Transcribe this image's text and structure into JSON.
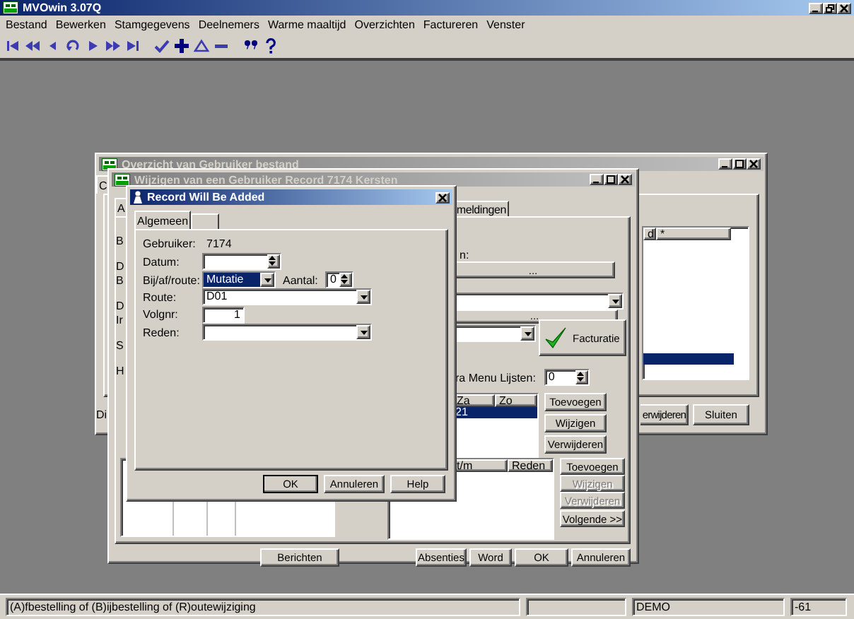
{
  "app": {
    "title": "MVOwin 3.07Q"
  },
  "menu": [
    "Bestand",
    "Bewerken",
    "Stamgegevens",
    "Deelnemers",
    "Warme maaltijd",
    "Overzichten",
    "Factureren",
    "Venster"
  ],
  "toolbar": [
    {
      "items": [
        {
          "kind": "first"
        },
        {
          "kind": "rewind"
        },
        {
          "kind": "previous"
        },
        {
          "kind": "undo"
        },
        {
          "kind": "next"
        },
        {
          "kind": "forward"
        },
        {
          "kind": "last"
        }
      ]
    },
    {
      "items": [
        {
          "kind": "check"
        },
        {
          "kind": "plus"
        },
        {
          "kind": "delta"
        },
        {
          "kind": "minus"
        }
      ]
    },
    {
      "items": [
        {
          "kind": "quote"
        },
        {
          "kind": "help"
        }
      ]
    }
  ],
  "overview": {
    "title": "Overzicht van Gebruiker bestand",
    "tab_label": "C",
    "footer_label": "Di",
    "columns": [
      "d",
      "*"
    ],
    "rows": [
      {
        "selected": false
      },
      {
        "selected": false
      },
      {
        "selected": false
      },
      {
        "selected": false
      },
      {
        "selected": false
      },
      {
        "selected": false
      },
      {
        "selected": false
      },
      {
        "selected": false
      },
      {
        "selected": false
      },
      {
        "selected": false
      },
      {
        "selected": true
      }
    ],
    "buttons": [
      "erwijderen",
      "Sluiten"
    ]
  },
  "editor": {
    "title": "Wijzigen van een Gebruiker Record 7174 Kersten",
    "tabs": [
      {
        "label": "A",
        "selected": true
      },
      {
        "label": "meldingen",
        "selected": false
      }
    ],
    "side_labels": [
      [
        "B"
      ],
      [
        "D",
        "B"
      ],
      [
        "D",
        "Ir"
      ],
      [
        "S"
      ],
      [
        "H"
      ]
    ],
    "field_label": "n:",
    "browse_buttons": [
      "...",
      "..."
    ],
    "invoice_button": "Facturatie",
    "menu_lists": {
      "label": "ra Menu Lijsten:",
      "value": "0"
    },
    "days_list": {
      "columns": [
        "Za",
        "Zo"
      ],
      "rows": [
        {
          "cells": [
            "21"
          ],
          "selected": true
        }
      ]
    },
    "days_buttons": [
      {
        "label": "Toevoegen",
        "disabled": false
      },
      {
        "label": "Wijzigen",
        "disabled": false
      },
      {
        "label": "Verwijderen",
        "disabled": false
      }
    ],
    "absence_list": {
      "columns": [
        "t/m",
        "Reden"
      ]
    },
    "absence_buttons": [
      {
        "label": "Toevoegen",
        "disabled": false
      },
      {
        "label": "Wijzigen",
        "disabled": true
      },
      {
        "label": "Verwijderen",
        "disabled": true
      },
      {
        "label": "Volgende >>",
        "disabled": false
      }
    ],
    "footer_buttons": [
      "Berichten",
      "Absenties",
      "Word",
      "OK",
      "Annuleren"
    ]
  },
  "dialog": {
    "title": "Record Will Be Added",
    "tabs": [
      {
        "label": "Algemeen",
        "selected": true
      },
      {
        "selected": false
      }
    ],
    "fields": [
      {
        "kind": "static",
        "label": "Gebruiker:",
        "value": "7174"
      },
      {
        "kind": "spin",
        "label": "Datum:"
      },
      {
        "kind": "short-combo",
        "label": "Bij/af/route:",
        "value": "Mutatie",
        "selected": true,
        "extra": {
          "label": "Aantal:",
          "value": "0"
        }
      },
      {
        "kind": "combo",
        "label": "Route:",
        "value": "D01"
      },
      {
        "kind": "number",
        "label": "Volgnr:",
        "value": "1"
      },
      {
        "kind": "combo",
        "label": "Reden:"
      }
    ],
    "buttons": [
      {
        "label": "OK",
        "default": true
      },
      {
        "label": "Annuleren",
        "default": false
      },
      {
        "label": "Help",
        "default": false
      }
    ]
  },
  "status_bar": [
    {
      "kind": "text",
      "text": "(A)fbestelling of (B)ijbestelling of (R)outewijziging"
    },
    {
      "kind": "blank"
    },
    {
      "kind": "text",
      "text": "DEMO"
    },
    {
      "kind": "text",
      "text": "-61"
    }
  ]
}
